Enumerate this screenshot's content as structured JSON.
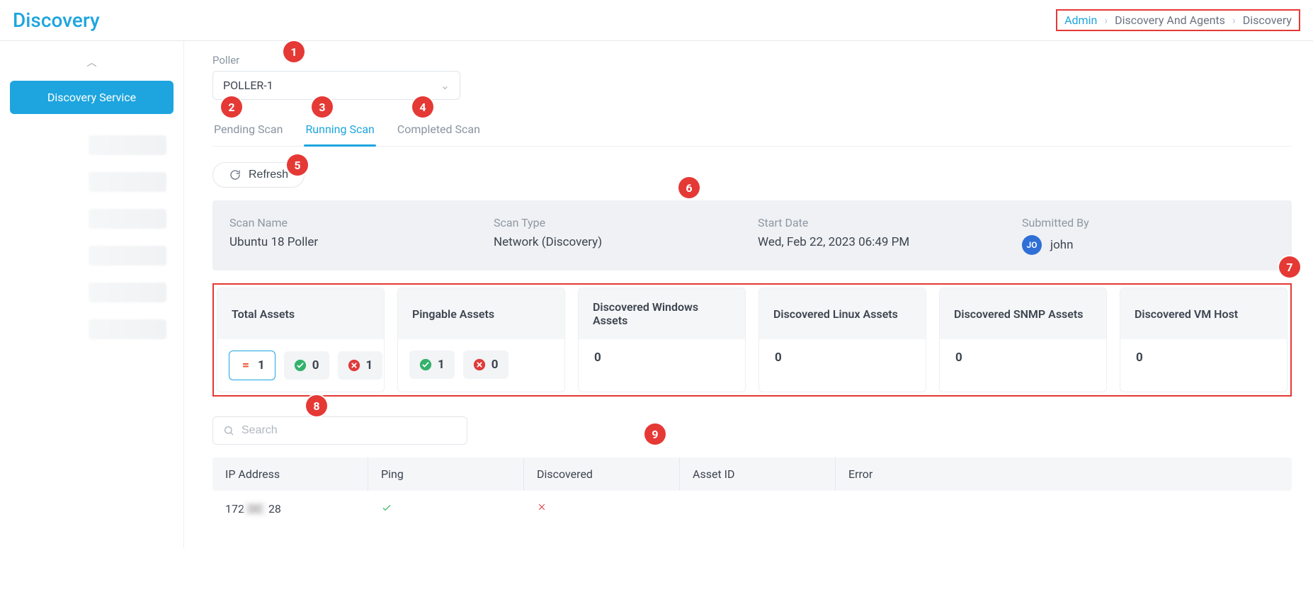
{
  "header": {
    "title": "Discovery",
    "breadcrumb": {
      "admin": "Admin",
      "mid": "Discovery And Agents",
      "last": "Discovery"
    }
  },
  "sidebar": {
    "active": "Discovery Service"
  },
  "poller": {
    "label": "Poller",
    "value": "POLLER-1"
  },
  "tabs": {
    "pending": "Pending Scan",
    "running": "Running Scan",
    "completed": "Completed Scan",
    "active_index": 1
  },
  "refresh": {
    "label": "Refresh"
  },
  "summary": {
    "scan_name_label": "Scan Name",
    "scan_name": "Ubuntu 18 Poller",
    "scan_type_label": "Scan Type",
    "scan_type": "Network (Discovery)",
    "start_date_label": "Start Date",
    "start_date": "Wed, Feb 22, 2023 06:49 PM",
    "submitted_by_label": "Submitted By",
    "submitted_by": "john",
    "avatar_initials": "JO"
  },
  "cards": {
    "total_assets": {
      "title": "Total Assets",
      "eq": "1",
      "ok": "0",
      "err": "1"
    },
    "pingable_assets": {
      "title": "Pingable Assets",
      "ok": "1",
      "err": "0"
    },
    "windows_assets": {
      "title": "Discovered Windows Assets",
      "value": "0"
    },
    "linux_assets": {
      "title": "Discovered Linux Assets",
      "value": "0"
    },
    "snmp_assets": {
      "title": "Discovered SNMP Assets",
      "value": "0"
    },
    "vm_host": {
      "title": "Discovered VM Host",
      "value": "0"
    }
  },
  "search": {
    "placeholder": "Search"
  },
  "table": {
    "headers": {
      "ip": "IP Address",
      "ping": "Ping",
      "discovered": "Discovered",
      "asset_id": "Asset ID",
      "error": "Error"
    },
    "row": {
      "ip_prefix": "172",
      "ip_suffix": "28",
      "ping": true,
      "discovered": false,
      "asset_id": "",
      "error": ""
    }
  },
  "markers": {
    "m1": "1",
    "m2": "2",
    "m3": "3",
    "m4": "4",
    "m5": "5",
    "m6": "6",
    "m7": "7",
    "m8": "8",
    "m9": "9"
  }
}
